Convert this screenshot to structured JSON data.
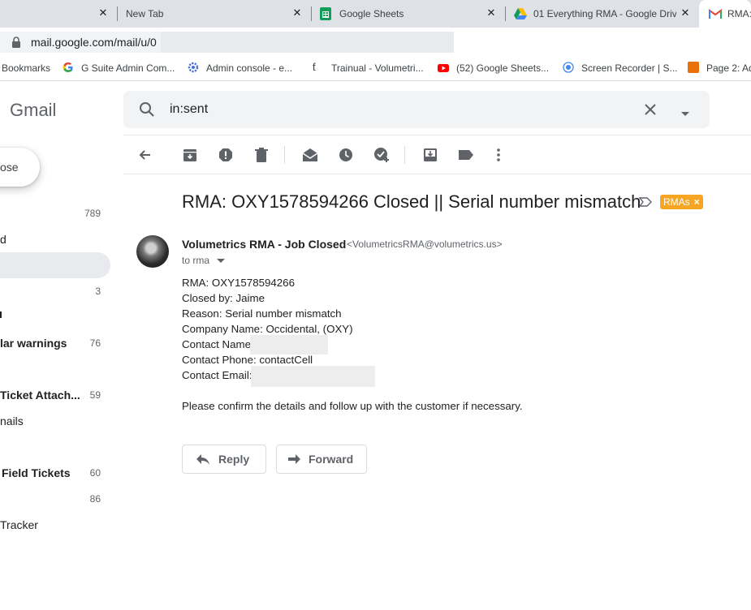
{
  "browser": {
    "tabs": [
      {
        "title": "",
        "active": false
      },
      {
        "title": "New Tab",
        "active": false
      },
      {
        "title": "Google Sheets",
        "active": false
      },
      {
        "title": "01 Everything RMA - Google Driv",
        "active": false
      },
      {
        "title": "RMA:",
        "active": true
      }
    ],
    "url": "mail.google.com/mail/u/0",
    "bookmarks": [
      {
        "label": "Bookmarks",
        "icon": "bookmarks-icon"
      },
      {
        "label": "G Suite Admin Com...",
        "icon": "google-g-icon"
      },
      {
        "label": "Admin console - e...",
        "icon": "admin-gear-icon"
      },
      {
        "label": "Trainual - Volumetri...",
        "icon": "trainual-icon"
      },
      {
        "label": "(52) Google Sheets...",
        "icon": "youtube-icon"
      },
      {
        "label": "Screen Recorder | S...",
        "icon": "screen-recorder-icon"
      },
      {
        "label": "Page 2: Ad",
        "icon": "page-icon"
      }
    ]
  },
  "gmail": {
    "logo": "Gmail",
    "search": {
      "query": "in:sent"
    },
    "compose_label": "ose",
    "nav": [
      {
        "label": "",
        "count": "789",
        "bold": false
      },
      {
        "label": "d",
        "count": "",
        "bold": false
      },
      {
        "label": "",
        "count": "",
        "bold": false,
        "active": true
      },
      {
        "label": "",
        "count": "3",
        "bold": false
      },
      {
        "label": "lar warnings",
        "count": "76",
        "bold": true
      },
      {
        "label": "Ticket Attach...",
        "count": "59",
        "bold": true
      },
      {
        "label": "nails",
        "count": "",
        "bold": false
      },
      {
        "label": "Field Tickets",
        "count": "60",
        "bold": true
      },
      {
        "label": "",
        "count": "86",
        "bold": false
      },
      {
        "label": "Tracker",
        "count": "",
        "bold": false
      }
    ],
    "toolbar_icons": [
      "back-arrow-icon",
      "archive-icon",
      "report-spam-icon",
      "delete-icon",
      "mark-unread-icon",
      "snooze-icon",
      "add-task-icon",
      "move-to-icon",
      "label-icon",
      "more-icon"
    ]
  },
  "message": {
    "subject": "RMA: OXY1578594266 Closed || Serial number mismatch",
    "label_chip": "RMAs",
    "label_color": "#f6a622",
    "sender_name": "Volumetrics RMA - Job Closed",
    "sender_email": "<VolumetricsRMA@volumetrics.us>",
    "to": "to rma",
    "body": [
      "RMA: OXY1578594266",
      "Closed by: Jaime",
      "Reason: Serial number mismatch",
      "Company Name: Occidental, (OXY)",
      "Contact Name",
      "Contact Phone: contactCell",
      "Contact Email:"
    ],
    "closing": "Please confirm the details and follow up with the customer if necessary.",
    "reply_label": "Reply",
    "forward_label": "Forward"
  }
}
